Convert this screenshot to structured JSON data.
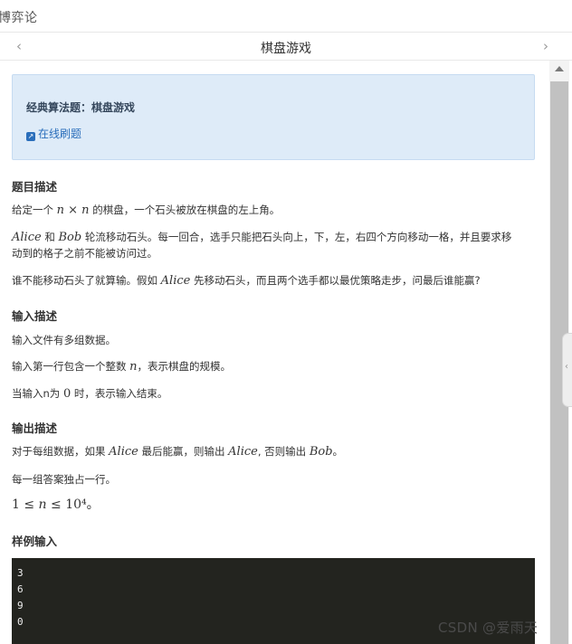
{
  "app": {
    "title": "博弈论"
  },
  "nav": {
    "title": "棋盘游戏",
    "back_icon": "chevron-left-icon",
    "forward_icon": "chevron-right-icon"
  },
  "card": {
    "title": "经典算法题：棋盘游戏",
    "link_label": "在线刷题",
    "link_icon": "external-link-icon"
  },
  "sections": {
    "desc_heading": "题目描述",
    "desc_p1": [
      "给定一个",
      "n × n",
      "的棋盘，一个石头被放在棋盘的左上角。"
    ],
    "desc_p2_line1": [
      "Alice",
      "和",
      "Bob",
      "轮流移动石头。每一回合，选手只能把石头向上，下，左，右四个方向移动一格，并且要求移"
    ],
    "desc_p2_line2": "动到的格子之前不能被访问过。",
    "desc_p3": [
      "谁不能移动石头了就算输。假如",
      "Alice",
      "先移动石头，而且两个选手都以最优策略走步，问最后谁能赢?"
    ],
    "input_heading": "输入描述",
    "input_p1": "输入文件有多组数据。",
    "input_p2": [
      "输入第一行包含一个整数",
      "n",
      "，表示棋盘的规模。"
    ],
    "input_p3": [
      "当输入n为",
      "0",
      "时，表示输入结束。"
    ],
    "output_heading": "输出描述",
    "output_p1": [
      "对于每组数据，如果",
      "Alice",
      "最后能赢，则输出",
      "Alice",
      ", 否则输出",
      "Bob",
      "。"
    ],
    "output_p2": "每一组答案独占一行。",
    "output_p3": [
      "1 ≤",
      "n",
      "≤ 10⁴",
      "。"
    ],
    "sample_heading": "样例输入",
    "sample_lines": [
      "3",
      "6",
      "9",
      "0"
    ]
  },
  "watermark": "CSDN @爱雨天"
}
